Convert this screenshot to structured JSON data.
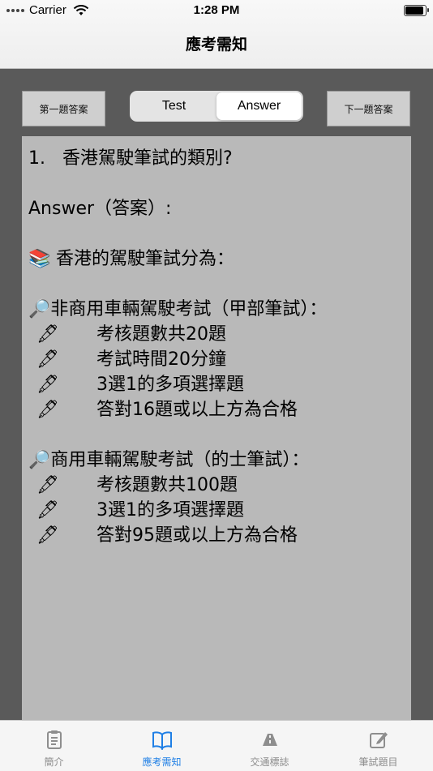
{
  "status_bar": {
    "carrier": "Carrier",
    "time": "1:28 PM"
  },
  "nav": {
    "title": "應考需知"
  },
  "controls": {
    "prev_answer": "第一題答案",
    "next_answer": "下一題答案",
    "segments": [
      {
        "label": "Test",
        "selected": false
      },
      {
        "label": "Answer",
        "selected": true
      }
    ]
  },
  "content": {
    "question": "1.   香港駕駛筆試的類別?",
    "answer_label": "Answer（答案）:",
    "intro_emoji": "📚",
    "intro": "香港的駕駛筆試分為：",
    "magnifier": "🔎",
    "pen": "🖋",
    "section1_title": "非商用車輛駕駛考試（甲部筆試）：",
    "section1_items": [
      "考核題數共20題",
      "考試時間20分鐘",
      "3選1的多項選擇題",
      "答對16題或以上方為合格"
    ],
    "section2_title": "商用車輛駕駛考試（的士筆試）：",
    "section2_items": [
      "考核題數共100題",
      "3選1的多項選擇題",
      "答對95題或以上方為合格"
    ]
  },
  "tabs": [
    {
      "label": "簡介",
      "icon": "clipboard-icon",
      "active": false
    },
    {
      "label": "應考需知",
      "icon": "book-icon",
      "active": true
    },
    {
      "label": "交通標誌",
      "icon": "road-icon",
      "active": false
    },
    {
      "label": "筆試題目",
      "icon": "edit-icon",
      "active": false
    }
  ],
  "colors": {
    "accent": "#1f7fe5",
    "panel": "#b9b9b9",
    "background": "#5a5a5a"
  }
}
